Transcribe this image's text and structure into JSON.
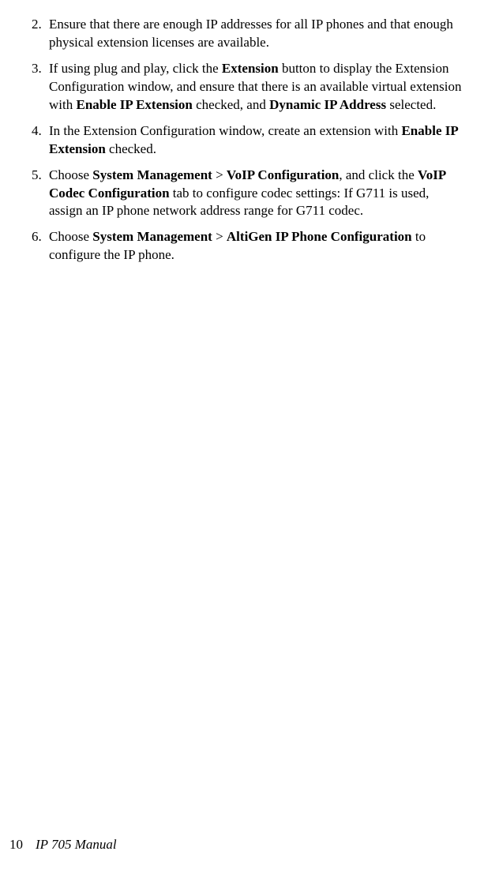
{
  "items": [
    {
      "marker": "2.",
      "segments": [
        {
          "text": "Ensure that there are enough IP addresses for all IP phones and that enough physical extension licenses are available.",
          "bold": false
        }
      ]
    },
    {
      "marker": "3.",
      "segments": [
        {
          "text": "If using plug and play, click the ",
          "bold": false
        },
        {
          "text": "Extension",
          "bold": true
        },
        {
          "text": " button to display the Extension Configuration window, and ensure that there is an available virtual extension with ",
          "bold": false
        },
        {
          "text": "Enable IP Extension",
          "bold": true
        },
        {
          "text": " checked, and ",
          "bold": false
        },
        {
          "text": "Dynamic IP Address",
          "bold": true
        },
        {
          "text": " selected.",
          "bold": false
        }
      ]
    },
    {
      "marker": "4.",
      "segments": [
        {
          "text": "In the Extension Configuration window, create an extension with ",
          "bold": false
        },
        {
          "text": "Enable IP Extension",
          "bold": true
        },
        {
          "text": " checked.",
          "bold": false
        }
      ]
    },
    {
      "marker": "5.",
      "segments": [
        {
          "text": "Choose ",
          "bold": false
        },
        {
          "text": "System Management",
          "bold": true
        },
        {
          "text": " > ",
          "bold": false
        },
        {
          "text": "VoIP Configuration",
          "bold": true
        },
        {
          "text": ", and click the ",
          "bold": false
        },
        {
          "text": "VoIP Codec Configuration",
          "bold": true
        },
        {
          "text": " tab to configure codec settings: If G711 is used, assign an IP phone network address range for G711 codec.",
          "bold": false
        }
      ]
    },
    {
      "marker": "6.",
      "segments": [
        {
          "text": "Choose ",
          "bold": false
        },
        {
          "text": "System Management",
          "bold": true
        },
        {
          "text": " > ",
          "bold": false
        },
        {
          "text": "AltiGen IP Phone Configuration",
          "bold": true
        },
        {
          "text": " to configure the IP phone.",
          "bold": false
        }
      ]
    }
  ],
  "footer": {
    "page_number": "10",
    "title": "IP 705 Manual"
  }
}
